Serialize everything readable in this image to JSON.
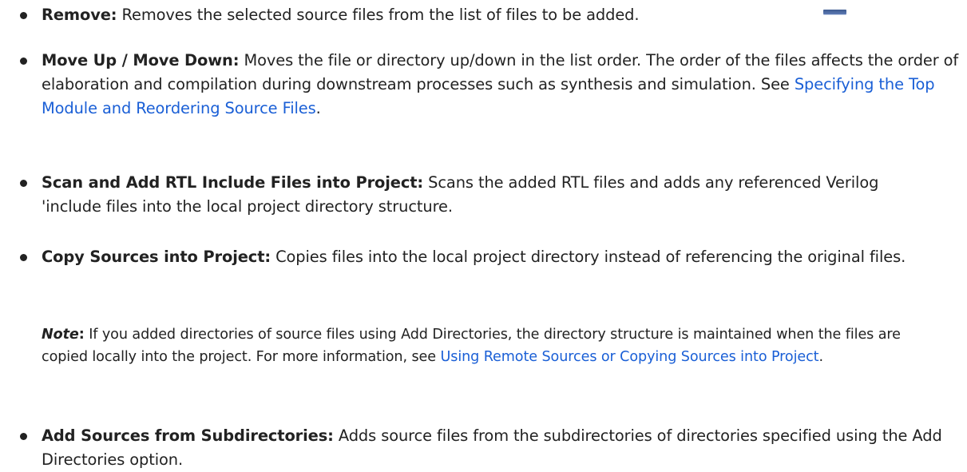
{
  "items": [
    {
      "term": "Remove:",
      "desc": " Removes the selected source files from the list of files to be added.",
      "icon": "remove-icon"
    },
    {
      "term": "Move Up / Move Down:",
      "desc": " Moves the file or directory up/down in the list order. The order of the files affects the order of elaboration and compilation during downstream processes such as synthesis and simulation. See ",
      "link": "Specifying the Top Module and Reordering Source Files",
      "after": "."
    },
    {
      "term": "Scan and Add RTL Include Files into Project:",
      "desc": " Scans the added RTL files and adds any referenced Verilog 'include files into the local project directory structure."
    },
    {
      "term": "Copy Sources into Project:",
      "desc": " Copies files into the local project directory instead of referencing the original files."
    },
    {
      "term": "Add Sources from Subdirectories:",
      "desc": " Adds source files from the subdirectories of directories specified using the Add Directories option."
    }
  ],
  "note": {
    "label": "Note",
    "colon": ":",
    "text": " If you added directories of source files using Add Directories, the directory structure is maintained when the files are copied locally into the project. For more information, see ",
    "link": "Using Remote Sources or Copying Sources into Project",
    "after": "."
  },
  "colors": {
    "text": "#222222",
    "link": "#1a5fd6",
    "icon": "#3d5a90"
  }
}
